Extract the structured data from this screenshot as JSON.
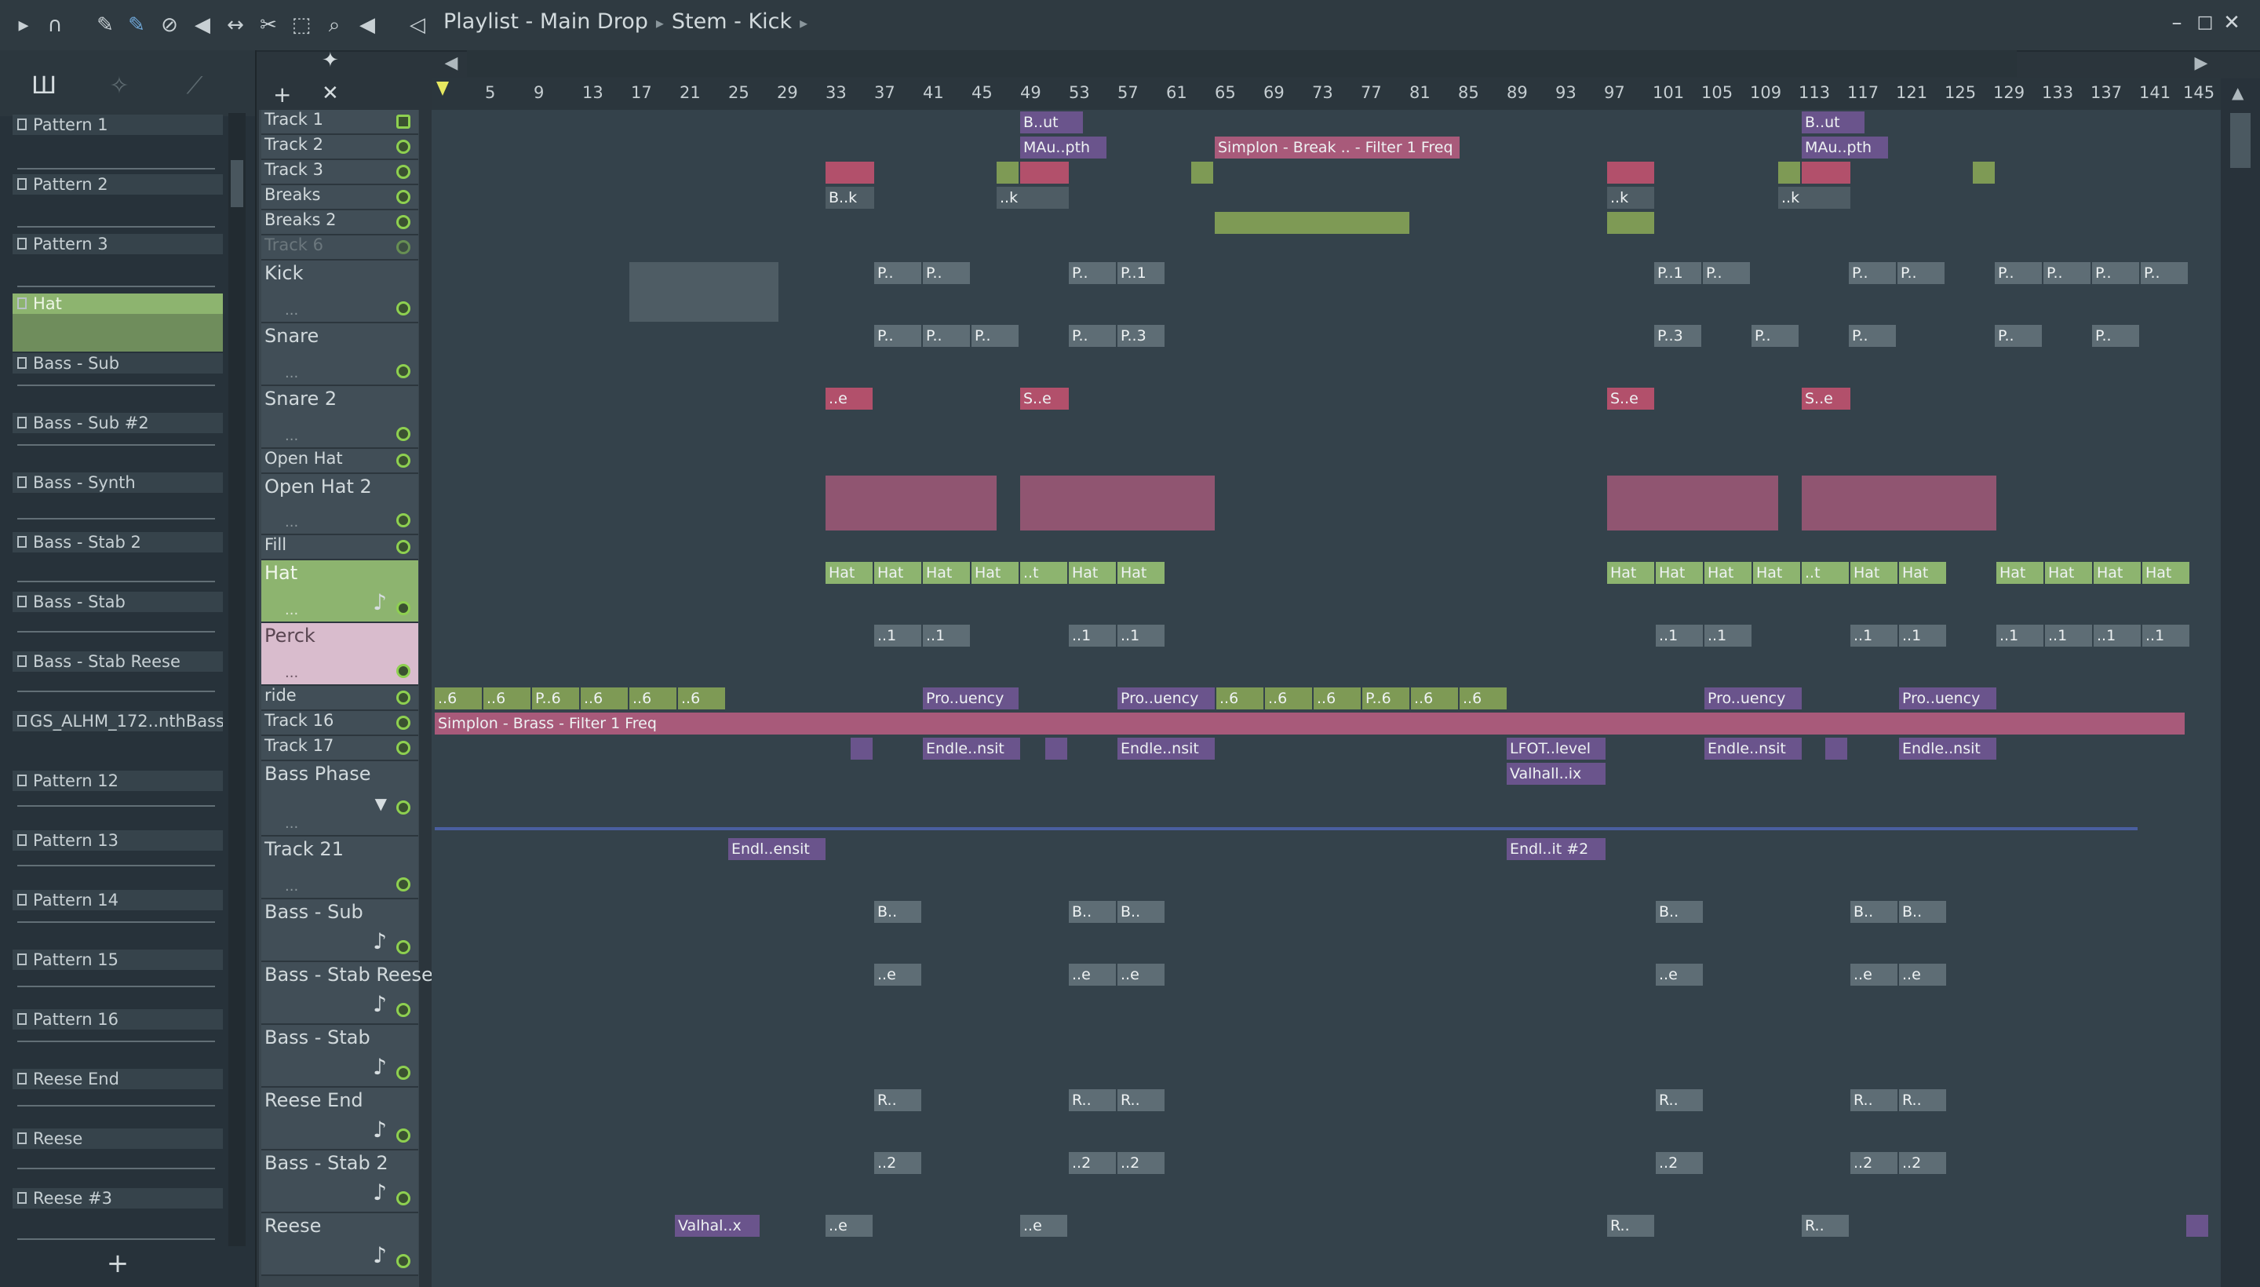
{
  "toolbar": {
    "icons": [
      "play-arrow-icon",
      "magnet-icon",
      "pencil-icon",
      "paint-brush-icon",
      "delete-icon",
      "mute-icon",
      "slip-icon",
      "slice-icon",
      "select-icon",
      "zoom-icon",
      "playback-icon"
    ],
    "title_parts": [
      "Playlist - Main Drop",
      "Stem - Kick"
    ],
    "window_buttons": [
      "minimize",
      "maximize",
      "close"
    ]
  },
  "browser": {
    "patterns": [
      {
        "label": "Pattern 1"
      },
      {
        "label": "Pattern 2"
      },
      {
        "label": "Pattern 3"
      },
      {
        "label": "Hat",
        "selected": true
      },
      {
        "label": "Bass - Sub"
      },
      {
        "label": "Bass - Sub #2"
      },
      {
        "label": "Bass - Synth"
      },
      {
        "label": "Bass - Stab 2"
      },
      {
        "label": "Bass - Stab"
      },
      {
        "label": "Bass - Stab Reese"
      },
      {
        "label": "GS_ALHM_172..nthBass_01"
      },
      {
        "label": "Pattern 12"
      },
      {
        "label": "Pattern 13"
      },
      {
        "label": "Pattern 14"
      },
      {
        "label": "Pattern 15"
      },
      {
        "label": "Pattern 16"
      },
      {
        "label": "Reese End"
      },
      {
        "label": "Reese"
      },
      {
        "label": "Reese #3"
      }
    ],
    "add_label": "+"
  },
  "ruler": {
    "bars": [
      "5",
      "9",
      "13",
      "17",
      "21",
      "25",
      "29",
      "33",
      "37",
      "41",
      "45",
      "49",
      "53",
      "57",
      "61",
      "65",
      "69",
      "73",
      "77",
      "81",
      "85",
      "89",
      "93",
      "97",
      "101",
      "105",
      "109",
      "113",
      "117",
      "121",
      "125",
      "129",
      "133",
      "137",
      "141",
      "145"
    ]
  },
  "tracks": [
    {
      "name": "Track 1"
    },
    {
      "name": "Track 2"
    },
    {
      "name": "Track 3"
    },
    {
      "name": "Breaks"
    },
    {
      "name": "Breaks 2"
    },
    {
      "name": "Track 6"
    },
    {
      "name": "Kick"
    },
    {
      "name": "Snare"
    },
    {
      "name": "Snare 2"
    },
    {
      "name": "Open Hat"
    },
    {
      "name": "Open Hat 2"
    },
    {
      "name": "Fill"
    },
    {
      "name": "Hat"
    },
    {
      "name": "Perck"
    },
    {
      "name": "ride"
    },
    {
      "name": "Track 16"
    },
    {
      "name": "Track 17"
    },
    {
      "name": "Bass Phase"
    },
    {
      "name": "Track 21"
    },
    {
      "name": "Bass - Sub"
    },
    {
      "name": "Bass - Stab Reese"
    },
    {
      "name": "Bass - Stab"
    },
    {
      "name": "Reese End"
    },
    {
      "name": "Bass - Stab 2"
    },
    {
      "name": "Reese"
    }
  ],
  "clips": {
    "t1_a": "B..ut",
    "t1_b": "B..ut",
    "t2_a": "MAu..pth",
    "t2_b": "Simplon - Break .. - Filter 1 Freq",
    "t2_c": "MAu..pth",
    "breaks_a": "B..k",
    "breaks_b": "..k",
    "breaks_c": "..k",
    "breaks_d": "..k",
    "kick": "P..",
    "kick_b": "P..1",
    "snare_b": "P..3",
    "snare2": "..e",
    "snare2_b": "S..e",
    "hat": "Hat",
    "hat_t": "..t",
    "perck": "..1",
    "ride_a": "..6",
    "ride_b": "P..6",
    "ride_c": "Pro..uency",
    "track16": "Simplon - Brass - Filter 1 Freq",
    "track17_a": "Endle..nsit",
    "track17_b": "LFOT..level",
    "bassphase": "Valhall..ix",
    "track21_a": "Endl..ensit",
    "track21_b": "Endl..it #2",
    "bsub": "B..",
    "bstabreese": "..e",
    "reeseend": "R..",
    "bstab2": "..2",
    "reese_a": "Valhal..x",
    "reese_b": "..e",
    "reese_c": "R.."
  }
}
